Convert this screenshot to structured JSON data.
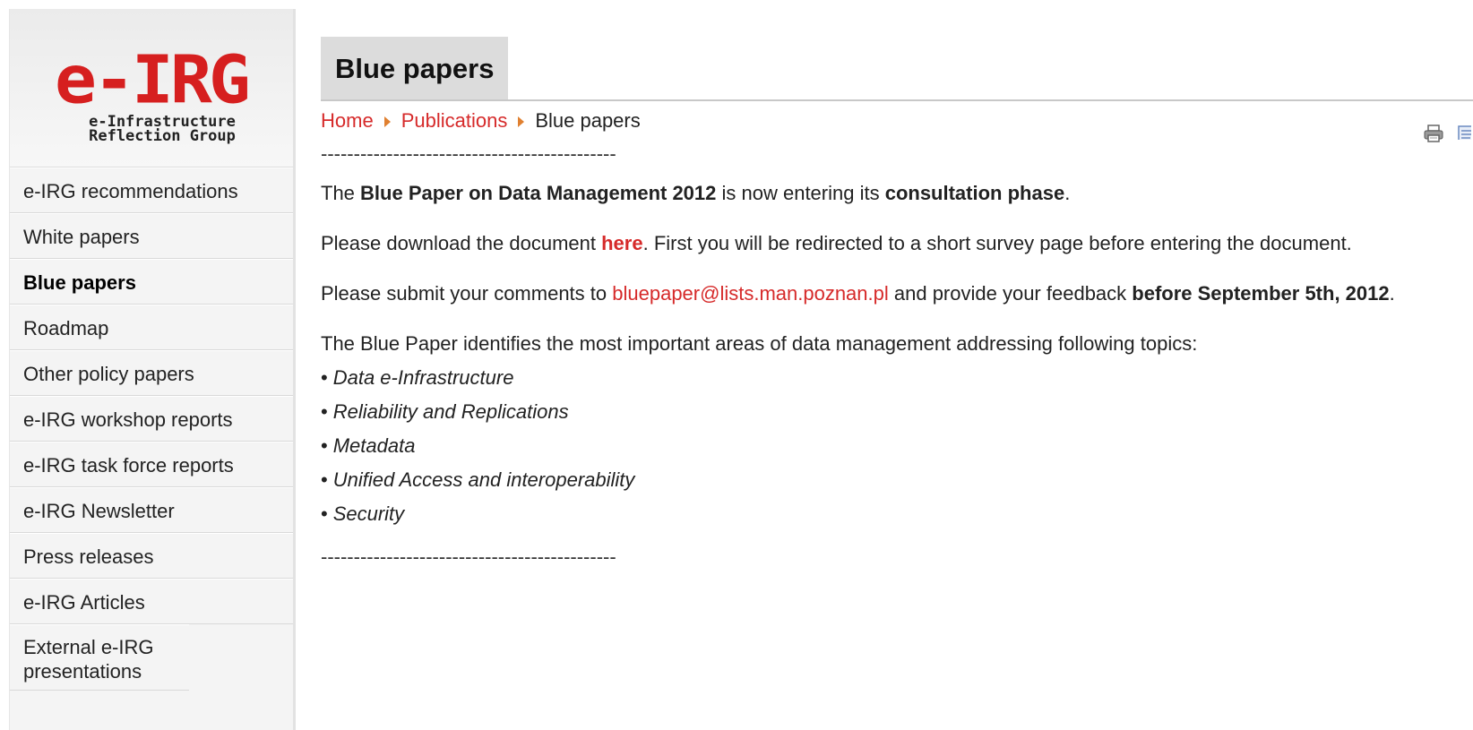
{
  "logo": {
    "mark": "e-IRG",
    "sub_line1": "e-Infrastructure",
    "sub_line2": "Reflection Group"
  },
  "sidebar": {
    "items": [
      {
        "label": "e-IRG recommendations"
      },
      {
        "label": "White papers"
      },
      {
        "label": "Blue papers"
      },
      {
        "label": "Roadmap"
      },
      {
        "label": "Other policy papers"
      },
      {
        "label": "e-IRG workshop reports"
      },
      {
        "label": "e-IRG task force reports"
      },
      {
        "label": "e-IRG Newsletter"
      },
      {
        "label": "Press releases"
      },
      {
        "label": "e-IRG Articles"
      },
      {
        "label": "External e-IRG presentations"
      }
    ]
  },
  "main": {
    "title": "Blue papers",
    "breadcrumb": {
      "home": "Home",
      "publications": "Publications",
      "current": "Blue papers"
    },
    "dashes": "---------------------------------------------",
    "p1": {
      "a": "The ",
      "b": "Blue Paper on Data Management 2012",
      "c": " is now entering its ",
      "d": "consultation phase",
      "e": "."
    },
    "p2": {
      "a": "Please download the document ",
      "link": "here",
      "b": ". First you will be redirected to a short survey page before entering the document."
    },
    "p3": {
      "a": "Please submit your comments to ",
      "email": "bluepaper@lists.man.poznan.pl",
      "b": " and provide your feedback ",
      "c": "before September 5th, 2012",
      "d": "."
    },
    "p4": "The Blue Paper identifies the most important areas of data management addressing following topics:",
    "topics": [
      "Data e-Infrastructure",
      "Reliability and Replications",
      "Metadata",
      "Unified Access and interoperability",
      "Security"
    ],
    "bullet": "•"
  },
  "icons": {
    "print": "printer-icon",
    "email": "email-icon"
  },
  "colors": {
    "link": "#d62a2a",
    "accent": "#d61f1f",
    "crumb_arrow": "#e08030"
  }
}
